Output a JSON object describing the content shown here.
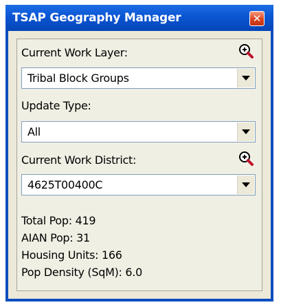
{
  "window": {
    "title": "TSAP Geography Manager",
    "close_glyph": "✕"
  },
  "work_layer": {
    "label": "Current Work Layer:",
    "value": "Tribal Block Groups",
    "zoom_icon": "magnifier-zoom-icon"
  },
  "update_type": {
    "label": "Update Type:",
    "value": "All"
  },
  "work_district": {
    "label": "Current Work District:",
    "value": "4625T00400C",
    "zoom_icon": "magnifier-zoom-icon"
  },
  "stats": {
    "total_pop": "Total Pop: 419",
    "aian_pop": "AIAN Pop: 31",
    "housing_units": "Housing Units:  166",
    "pop_density": "Pop Density (SqM): 6.0"
  },
  "colors": {
    "title_bar": "#0a55d2",
    "close_button": "#d8431f",
    "client_bg": "#ece9d8",
    "combo_border": "#7f9db9"
  }
}
